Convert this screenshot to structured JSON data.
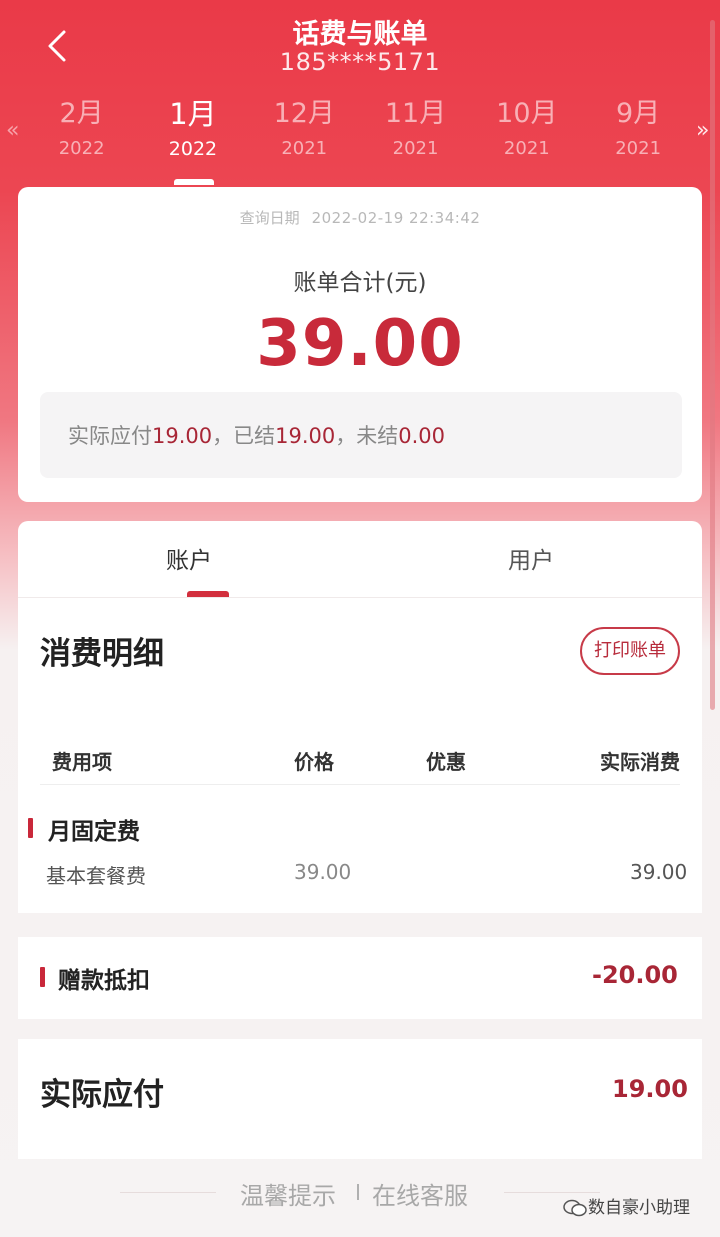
{
  "header": {
    "title": "话费与账单",
    "phone": "185****5171",
    "left_arrow": "«",
    "right_arrow": "»",
    "months": [
      {
        "month": "2月",
        "year": "2022"
      },
      {
        "month": "1月",
        "year": "2022"
      },
      {
        "month": "12月",
        "year": "2021"
      },
      {
        "month": "11月",
        "year": "2021"
      },
      {
        "month": "10月",
        "year": "2021"
      },
      {
        "month": "9月",
        "year": "2021"
      }
    ],
    "active_month_index": 1
  },
  "summary": {
    "query_date_label": "查询日期",
    "query_date_value": "2022-02-19 22:34:42",
    "total_label": "账单合计(元)",
    "total_amount": "39.00",
    "payable_label": "实际应付",
    "payable_value": "19.00",
    "settled_label": "，已结",
    "settled_value": "19.00",
    "unsettled_label": "，未结",
    "unsettled_value": "0.00"
  },
  "tabs": {
    "account": "账户",
    "user": "用户"
  },
  "details": {
    "title": "消费明细",
    "print_button": "打印账单",
    "columns": {
      "item": "费用项",
      "price": "价格",
      "discount": "优惠",
      "actual": "实际消费"
    },
    "group_name": "月固定费",
    "row": {
      "name": "基本套餐费",
      "price": "39.00",
      "actual": "39.00"
    }
  },
  "gift": {
    "label": "赠款抵扣",
    "amount": "-20.00"
  },
  "actual": {
    "label": "实际应付",
    "amount": "19.00"
  },
  "footer": {
    "tips": "温馨提示",
    "service": "在线客服"
  },
  "watermark": {
    "text": "数自豪小助理"
  },
  "colors": {
    "brand_red": "#e83a48",
    "amount_red": "#c82a3a",
    "dark_red": "#a82636"
  }
}
